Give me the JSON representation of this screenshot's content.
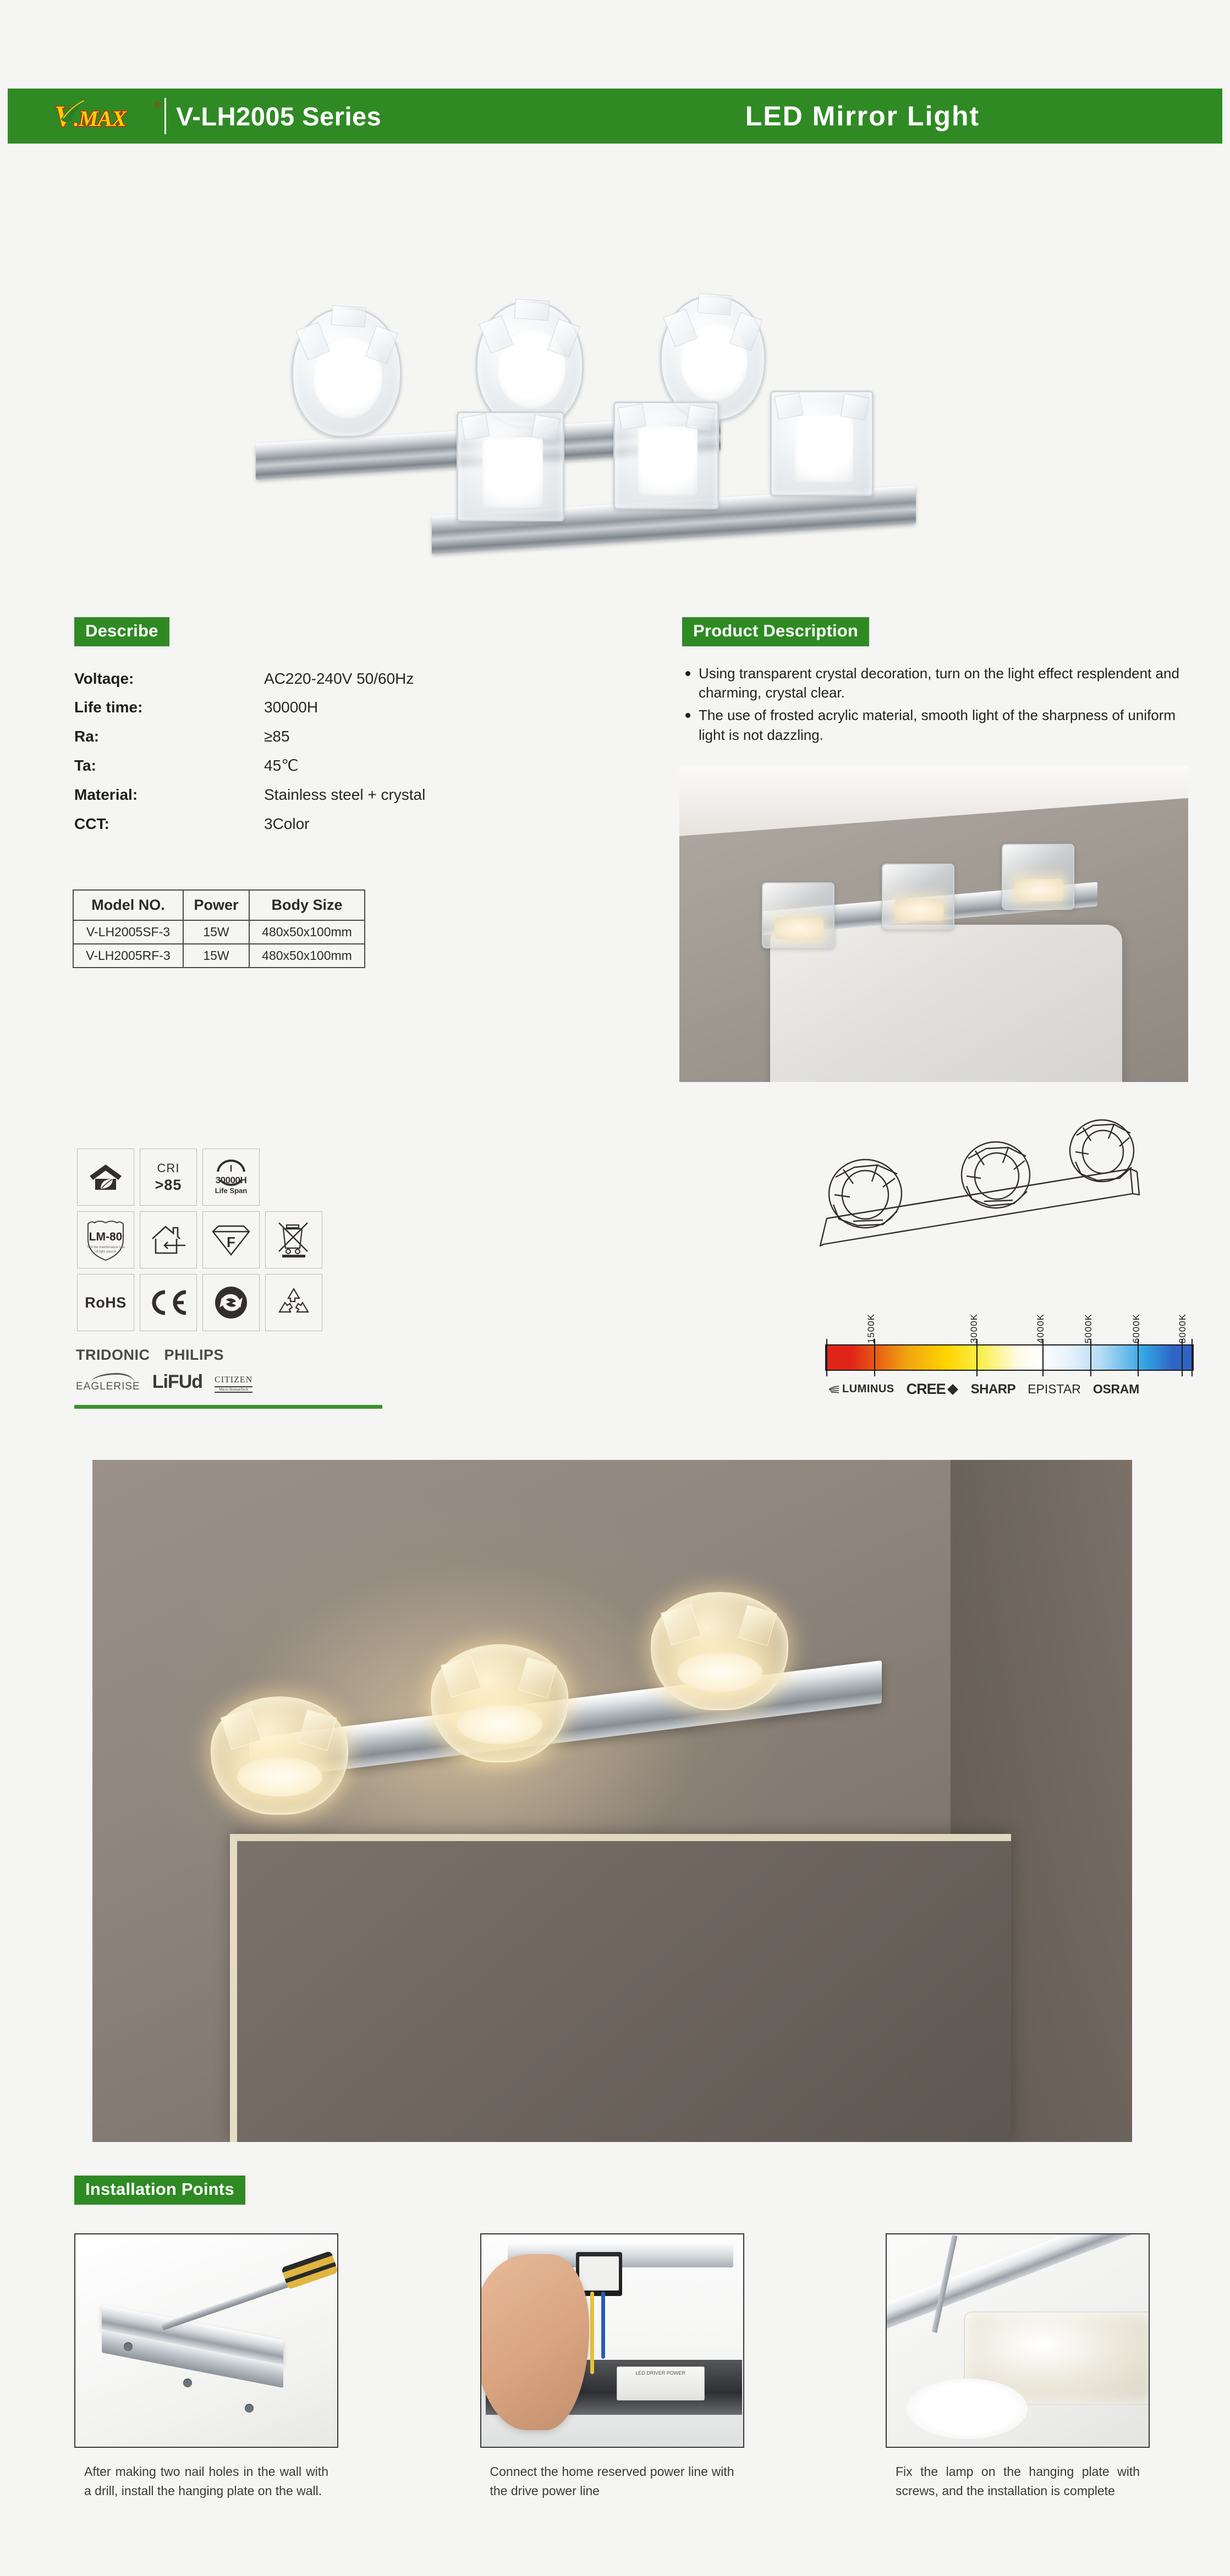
{
  "header": {
    "logo_main": "V",
    "logo_sub": ".MAX",
    "logo_registered": "®",
    "series": "V-LH2005 Series",
    "title": "LED Mirror Light",
    "brand_green": "#2f8a24"
  },
  "describe": {
    "badge": "Describe",
    "specs": [
      {
        "key": "Voltaqe:",
        "value": "AC220-240V 50/60Hz"
      },
      {
        "key": "Life time:",
        "value": "30000H"
      },
      {
        "key": "Ra:",
        "value": "≥85"
      },
      {
        "key": "Ta:",
        "value": "45℃"
      },
      {
        "key": "Material:",
        "value": "Stainless steel + crystal"
      },
      {
        "key": "CCT:",
        "value": "3Color"
      }
    ],
    "table": {
      "headers": [
        "Model NO.",
        "Power",
        "Body Size"
      ],
      "rows": [
        [
          "V-LH2005SF-3",
          "15W",
          "480x50x100mm"
        ],
        [
          "V-LH2005RF-3",
          "15W",
          "480x50x100mm"
        ]
      ]
    }
  },
  "product_description": {
    "badge": "Product Description",
    "bullets": [
      "Using transparent crystal decoration, turn on the light effect resplendent and charming, crystal clear.",
      "The use of frosted acrylic material, smooth light of the sharpness of uniform light is not dazzling."
    ]
  },
  "icons": {
    "cri_label": "CRI",
    "cri_value": ">85",
    "lifespan_value": "30000H",
    "lifespan_label": "Life Span",
    "lm80_label": "LM-80",
    "lm80_sub": "Test the maintenance rate of light source",
    "rohs_label": "RoHS",
    "ce_label": "CE",
    "f_mark": "F"
  },
  "driver_brands": {
    "row1": [
      "TRIDONIC",
      "PHILIPS"
    ],
    "row2": [
      "EAGLERISE",
      "LiFUd",
      "CITIZEN"
    ],
    "citizen_sub": "Micro HumanTech"
  },
  "cct": {
    "ticks": [
      "1500K",
      "3000K",
      "4000K",
      "5000K",
      "6000K",
      "8000K"
    ],
    "tick_positions": [
      13,
      41,
      59,
      72,
      85,
      97
    ],
    "chip_brands": [
      "LUMINUS",
      "CREE",
      "SHARP",
      "EPISTAR",
      "OSRAM"
    ]
  },
  "installation": {
    "badge": "Installation Points",
    "steps": [
      "After making two nail holes in the wall with a drill, install the hanging plate on the wall.",
      "Connect the home reserved power line with the drive power line",
      "Fix the lamp on the hanging plate with screws, and the installation is complete"
    ]
  },
  "driver_label": "LED DRIVER POWER"
}
